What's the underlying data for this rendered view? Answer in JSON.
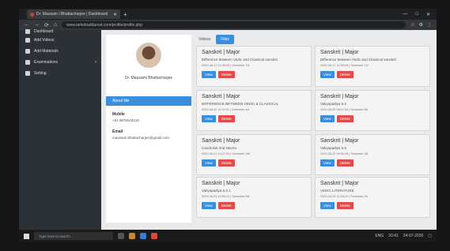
{
  "browser": {
    "tab_title": "Dr. Mausam i Bhattacharjee | Dashboard",
    "url": "www.tarkobaddarsat.com/profile/profile.php",
    "nav": [
      "←",
      "→",
      "⟳",
      "⌂"
    ],
    "window_controls": [
      "—",
      "□",
      "✕"
    ]
  },
  "sidebar": {
    "items": [
      {
        "label": "Dashboard",
        "icon": "dashboard-icon"
      },
      {
        "label": "Add Videos",
        "icon": "video-icon"
      },
      {
        "label": "Add Materials",
        "icon": "materials-icon"
      },
      {
        "label": "Examinations",
        "icon": "exam-icon"
      },
      {
        "label": "Setting",
        "icon": "setting-icon"
      }
    ]
  },
  "profile": {
    "name": "Dr. Mausami Bhattacharjee",
    "about_label": "About Me",
    "mobile_label": "Mobile",
    "mobile_value": "+91 9876543210",
    "email_label": "Email",
    "email_value": "mausami.bhattacharjee@gmail.com"
  },
  "main": {
    "tabs": [
      "Videos",
      "Files"
    ],
    "cards": [
      {
        "title": "Sanskrit | Major",
        "desc": "Difference between Vedic and Classical sanskrit",
        "meta": "2020-06-17 12:39:09 | Semester 1N",
        "view": "View",
        "delete": "Delete"
      },
      {
        "title": "Sanskrit | Major",
        "desc": "Difference between Vedic and Classical sanskrit",
        "meta": "2020-06-17 12:39:09 | Semester 1N",
        "view": "View",
        "delete": "Delete"
      },
      {
        "title": "Sanskrit | Major",
        "desc": "DIFFERENCE BETWEEN VEDIC & CLASSICAL",
        "meta": "2020-06-19 11:02:51 | Semester 4A",
        "view": "View",
        "delete": "Delete"
      },
      {
        "title": "Sanskrit | Major",
        "desc": "Vakyapadiya 6.2",
        "meta": "2020-06-20 08:11:34 | Semester 6B",
        "view": "View",
        "delete": "Delete"
      },
      {
        "title": "Sanskrit | Major",
        "desc": "Candrolok 2nd stanza",
        "meta": "2020-06-21 10:27:03 | Semester 3M",
        "view": "View",
        "delete": "Delete"
      },
      {
        "title": "Sanskrit | Major",
        "desc": "Vakyapadiya 6.5",
        "meta": "2020-06-22 09:40:18 | Semester 6B",
        "view": "View",
        "delete": "Delete"
      },
      {
        "title": "Sanskrit | Major",
        "desc": "Vakyapadiya 6.2.1",
        "meta": "2020-06-23 12:55:41 | Semester 6B",
        "view": "View",
        "delete": "Delete"
      },
      {
        "title": "Sanskrit | Major",
        "desc": "VEDIC LITERATURE",
        "meta": "2020-06-24 11:08:22 | Semester 2N",
        "view": "View",
        "delete": "Delete"
      }
    ]
  },
  "taskbar": {
    "search_placeholder": "Type here to search",
    "time": "20:41",
    "date": "24-07-2020",
    "lang": "ENG"
  }
}
